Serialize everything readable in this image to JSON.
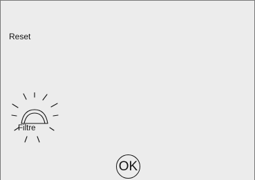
{
  "menu": {
    "reset_label": "Reset"
  },
  "filter": {
    "icon": "filter-reset-icon",
    "label": "Filtre"
  },
  "ok_button": {
    "label": "OK"
  },
  "colors": {
    "panel_background": "#ececec",
    "border": "#777777",
    "text": "#111111"
  }
}
